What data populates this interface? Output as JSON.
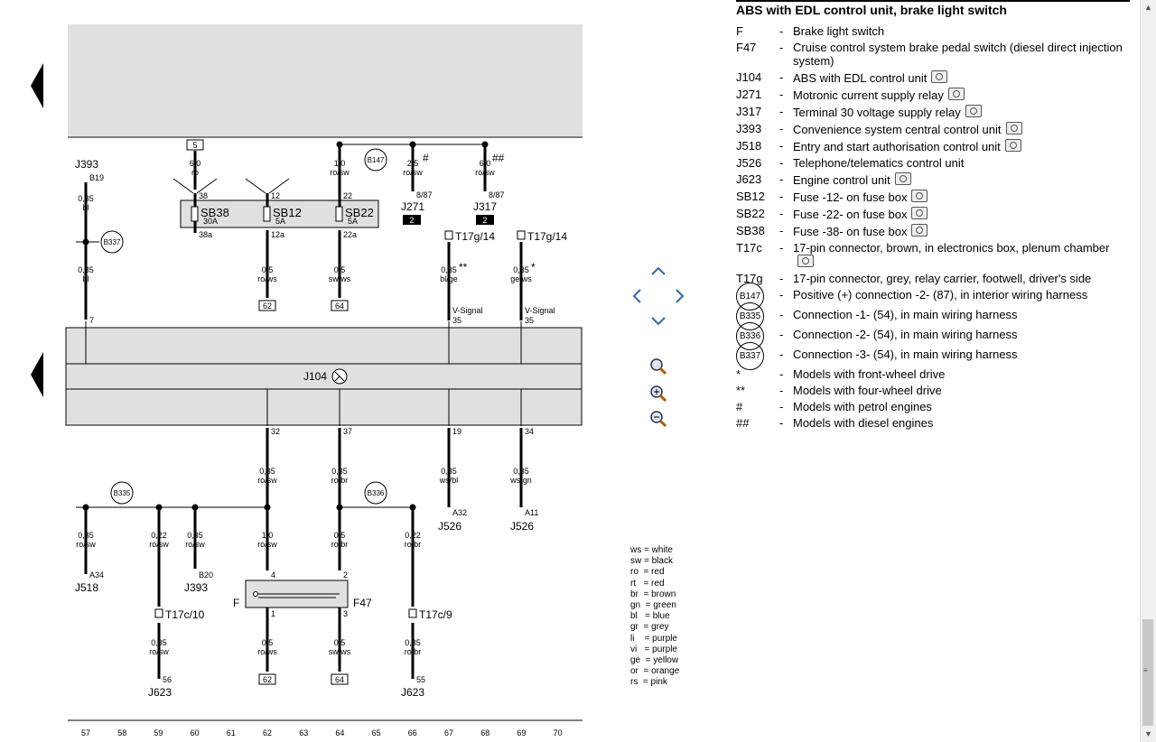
{
  "diagram": {
    "top_numbers": {
      "f5": "5"
    },
    "components": {
      "J393_top": "J393",
      "B19": "B19",
      "B337": "B337",
      "B147": "B147",
      "J271": "J271",
      "J317": "J317",
      "T17g14a": "T17g/14",
      "T17g14b": "T17g/14",
      "J104": "J104",
      "B335": "B335",
      "B336": "B336",
      "F": "F",
      "F47": "F47",
      "J518": "J518",
      "J393_bot": "J393",
      "T17c10": "T17c/10",
      "T17c9": "T17c/9",
      "J623a": "J623",
      "J623b": "J623",
      "J526a": "J526",
      "J526b": "J526",
      "SB38": "SB38",
      "SB12": "SB12",
      "SB22": "SB22"
    },
    "wire_labels": {
      "w1a": "0,35",
      "w1b": "bl",
      "w1c": "0,35",
      "w1d": "bl",
      "w2a": "6,0",
      "w2b": "ro",
      "w3a": "1,0",
      "w3b": "ro/sw",
      "w4a": "2,5",
      "w4b": "ro/sw",
      "w4m": "#",
      "w5a": "6,0",
      "w5b": "ro/sw",
      "w5m": "##",
      "w6a": "0,5",
      "w6b": "ro/ws",
      "w7a": "0,5",
      "w7b": "sw/ws",
      "w8a": "0,35",
      "w8b": "bl/ge",
      "w8m": "**",
      "w9a": "0,35",
      "w9b": "ge/ws",
      "w9m": "*",
      "w10a": "0,35",
      "w10b": "ro/sw",
      "w11a": "0,35",
      "w11b": "ro/br",
      "w12a": "0,35",
      "w12b": "ws/bl",
      "w13a": "0,35",
      "w13b": "ws/gn",
      "w14a": "0,35",
      "w14b": "ro/sw",
      "w15a": "0,22",
      "w15b": "ro/sw",
      "w16a": "0,35",
      "w16b": "ro/sw",
      "w17a": "1,0",
      "w17b": "ro/sw",
      "w18a": "0,5",
      "w18b": "ro/br",
      "w19a": "0,22",
      "w19b": "ro/br",
      "w20a": "0,5",
      "w20b": "ro/ws",
      "w21a": "0,5",
      "w21b": "sw/ws",
      "w22a": "0,35",
      "w22b": "ro/sw",
      "w23a": "0,35",
      "w23b": "ro/br"
    },
    "pins": {
      "p7": "7",
      "p38": "38",
      "p12": "12",
      "p22": "22",
      "p38a": "38a",
      "p12a": "12a",
      "p22a": "22a",
      "p887a": "8/87",
      "p887b": "8/87",
      "p35a": "35",
      "p35b": "35",
      "p32": "32",
      "p37": "37",
      "p19": "19",
      "p34": "34",
      "pA32": "A32",
      "pA11": "A11",
      "pA34": "A34",
      "pB20": "B20",
      "p4": "4",
      "p2": "2",
      "p1": "1",
      "p3": "3",
      "p56": "56",
      "p55": "55"
    },
    "fuse_ratings": {
      "sb38": "30A",
      "sb12": "5A",
      "sb22": "5A"
    },
    "boxes": {
      "b2a": "2",
      "b2b": "2",
      "b62a": "62",
      "b64a": "64",
      "b62b": "62",
      "b64b": "64"
    },
    "vsignal": {
      "a": "V-Signal",
      "b": "V-Signal"
    },
    "ruler": [
      "57",
      "58",
      "59",
      "60",
      "61",
      "62",
      "63",
      "64",
      "65",
      "66",
      "67",
      "68",
      "69",
      "70"
    ]
  },
  "legend": {
    "title": "ABS with EDL control unit, brake light switch",
    "items": [
      {
        "code": "F",
        "desc": "Brake light switch",
        "camera": false,
        "circle": false
      },
      {
        "code": "F47",
        "desc": "Cruise control system brake pedal switch (diesel direct injection system)",
        "camera": false,
        "circle": false
      },
      {
        "code": "J104",
        "desc": "ABS with EDL control unit",
        "camera": true,
        "circle": false
      },
      {
        "code": "J271",
        "desc": "Motronic current supply relay",
        "camera": true,
        "circle": false
      },
      {
        "code": "J317",
        "desc": "Terminal 30 voltage supply relay",
        "camera": true,
        "circle": false
      },
      {
        "code": "J393",
        "desc": "Convenience system central control unit",
        "camera": true,
        "circle": false
      },
      {
        "code": "J518",
        "desc": "Entry and start authorisation control unit",
        "camera": true,
        "circle": false
      },
      {
        "code": "J526",
        "desc": "Telephone/telematics control unit",
        "camera": false,
        "circle": false
      },
      {
        "code": "J623",
        "desc": "Engine control unit",
        "camera": true,
        "circle": false
      },
      {
        "code": "SB12",
        "desc": "Fuse -12- on fuse box",
        "camera": true,
        "circle": false
      },
      {
        "code": "SB22",
        "desc": "Fuse -22- on fuse box",
        "camera": true,
        "circle": false
      },
      {
        "code": "SB38",
        "desc": "Fuse -38- on fuse box",
        "camera": true,
        "circle": false
      },
      {
        "code": "T17c",
        "desc": "17-pin connector, brown, in electronics box, plenum chamber",
        "camera": true,
        "circle": false
      },
      {
        "code": "T17g",
        "desc": "17-pin connector, grey, relay carrier, footwell, driver's side",
        "camera": false,
        "circle": false
      },
      {
        "code": "B147",
        "desc": "Positive (+) connection -2- (87), in interior wiring harness",
        "camera": false,
        "circle": true
      },
      {
        "code": "B335",
        "desc": "Connection -1- (54), in main wiring harness",
        "camera": false,
        "circle": true
      },
      {
        "code": "B336",
        "desc": "Connection -2- (54), in main wiring harness",
        "camera": false,
        "circle": true
      },
      {
        "code": "B337",
        "desc": "Connection -3- (54), in main wiring harness",
        "camera": false,
        "circle": true
      },
      {
        "code": "*",
        "desc": "Models with front-wheel drive",
        "camera": false,
        "circle": false
      },
      {
        "code": "**",
        "desc": "Models with four-wheel drive",
        "camera": false,
        "circle": false
      },
      {
        "code": "#",
        "desc": "Models with petrol engines",
        "camera": false,
        "circle": false
      },
      {
        "code": "##",
        "desc": "Models with diesel engines",
        "camera": false,
        "circle": false
      }
    ]
  },
  "colors": [
    "ws = white",
    "sw = black",
    "ro  = red",
    "rt   = red",
    "br  = brown",
    "gn  = green",
    "bl   = blue",
    "gr  = grey",
    "li    = purple",
    "vi   = purple",
    "ge  = yellow",
    "or  = orange",
    "rs  = pink"
  ],
  "nav": {
    "up": "pan-up-icon",
    "left": "pan-left-icon",
    "right": "pan-right-icon",
    "down": "pan-down-icon",
    "zoom_fit": "zoom-fit-icon",
    "zoom_in": "zoom-in-icon",
    "zoom_out": "zoom-out-icon"
  },
  "palette": {
    "panel": "#e0e0e0",
    "wire": "#000000"
  }
}
